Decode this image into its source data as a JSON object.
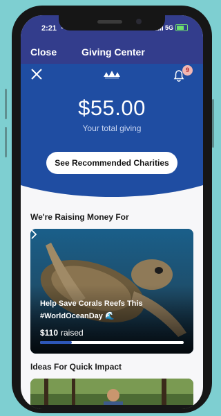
{
  "status_bar": {
    "time": "2:21",
    "network": "5G"
  },
  "nav": {
    "close_label": "Close",
    "title": "Giving Center"
  },
  "hero": {
    "total_amount": "$55.00",
    "total_caption": "Your total giving",
    "notification_count": "9",
    "recommended_button_label": "See Recommended Charities"
  },
  "raising": {
    "section_title": "We're Raising Money For",
    "card": {
      "title": "Help Save Corals Reefs This #WorldOceanDay 🌊",
      "raised_amount": "$110",
      "raised_label": "raised",
      "progress": 0.22
    }
  },
  "ideas": {
    "section_title": "Ideas For Quick Impact"
  },
  "colors": {
    "nav_bg": "#333d8c",
    "hero_bg": "#1f4da2",
    "progress": "#2d56b8",
    "background": "#7ecfd1"
  },
  "icons": [
    "close-icon",
    "mute-icon",
    "signal-icon",
    "battery-icon",
    "logo-icon",
    "bell-icon",
    "wave-icon",
    "chevron-right-icon"
  ]
}
